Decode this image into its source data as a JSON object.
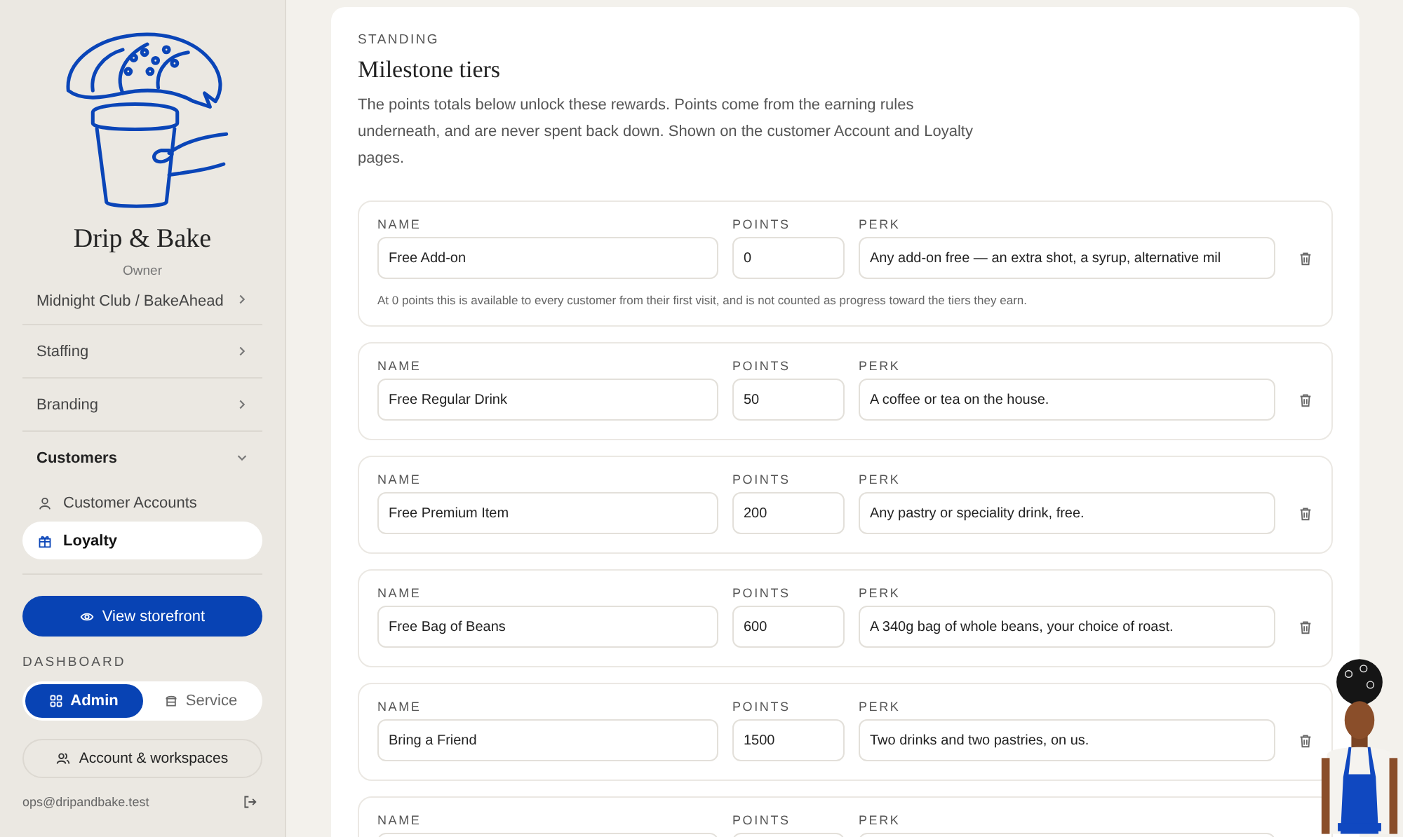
{
  "brand": {
    "name": "Drip & Bake",
    "role": "Owner"
  },
  "nav": [
    {
      "label": "Midnight Club / BakeAhead",
      "expanded": false
    },
    {
      "label": "Staffing",
      "expanded": false
    },
    {
      "label": "Branding",
      "expanded": false
    },
    {
      "label": "Customers",
      "expanded": true,
      "children": [
        {
          "label": "Customer Accounts",
          "selected": false
        },
        {
          "label": "Loyalty",
          "selected": true
        }
      ]
    }
  ],
  "storefront_button": "View storefront",
  "dashboard": {
    "label": "DASHBOARD",
    "options": [
      {
        "label": "Admin",
        "selected": true
      },
      {
        "label": "Service",
        "selected": false
      }
    ]
  },
  "account_button": "Account & workspaces",
  "email": "ops@dripandbake.test",
  "section": {
    "eyebrow": "STANDING",
    "title": "Milestone tiers",
    "description": "The points totals below unlock these rewards. Points come from the earning rules underneath, and are never spent back down. Shown on the customer Account and Loyalty pages.",
    "tiers": [
      {
        "name_label": "NAME",
        "points_label": "POINTS",
        "perk_label": "PERK",
        "name": "Free Add-on",
        "points": "0",
        "perk": "Any add-on free — an extra shot, a syrup, alternative mil",
        "note": "At 0 points this is available to every customer from their first visit, and is not counted as progress toward the tiers they earn."
      },
      {
        "name_label": "NAME",
        "points_label": "POINTS",
        "perk_label": "PERK",
        "name": "Free Regular Drink",
        "points": "50",
        "perk": "A coffee or tea on the house."
      },
      {
        "name_label": "NAME",
        "points_label": "POINTS",
        "perk_label": "PERK",
        "name": "Free Premium Item",
        "points": "200",
        "perk": "Any pastry or speciality drink, free."
      },
      {
        "name_label": "NAME",
        "points_label": "POINTS",
        "perk_label": "PERK",
        "name": "Free Bag of Beans",
        "points": "600",
        "perk": "A 340g bag of whole beans, your choice of roast."
      },
      {
        "name_label": "NAME",
        "points_label": "POINTS",
        "perk_label": "PERK",
        "name": "Bring a Friend",
        "points": "1500",
        "perk": "Two drinks and two pastries, on us."
      },
      {
        "name_label": "NAME",
        "points_label": "POINTS",
        "perk_label": "PERK"
      }
    ]
  }
}
